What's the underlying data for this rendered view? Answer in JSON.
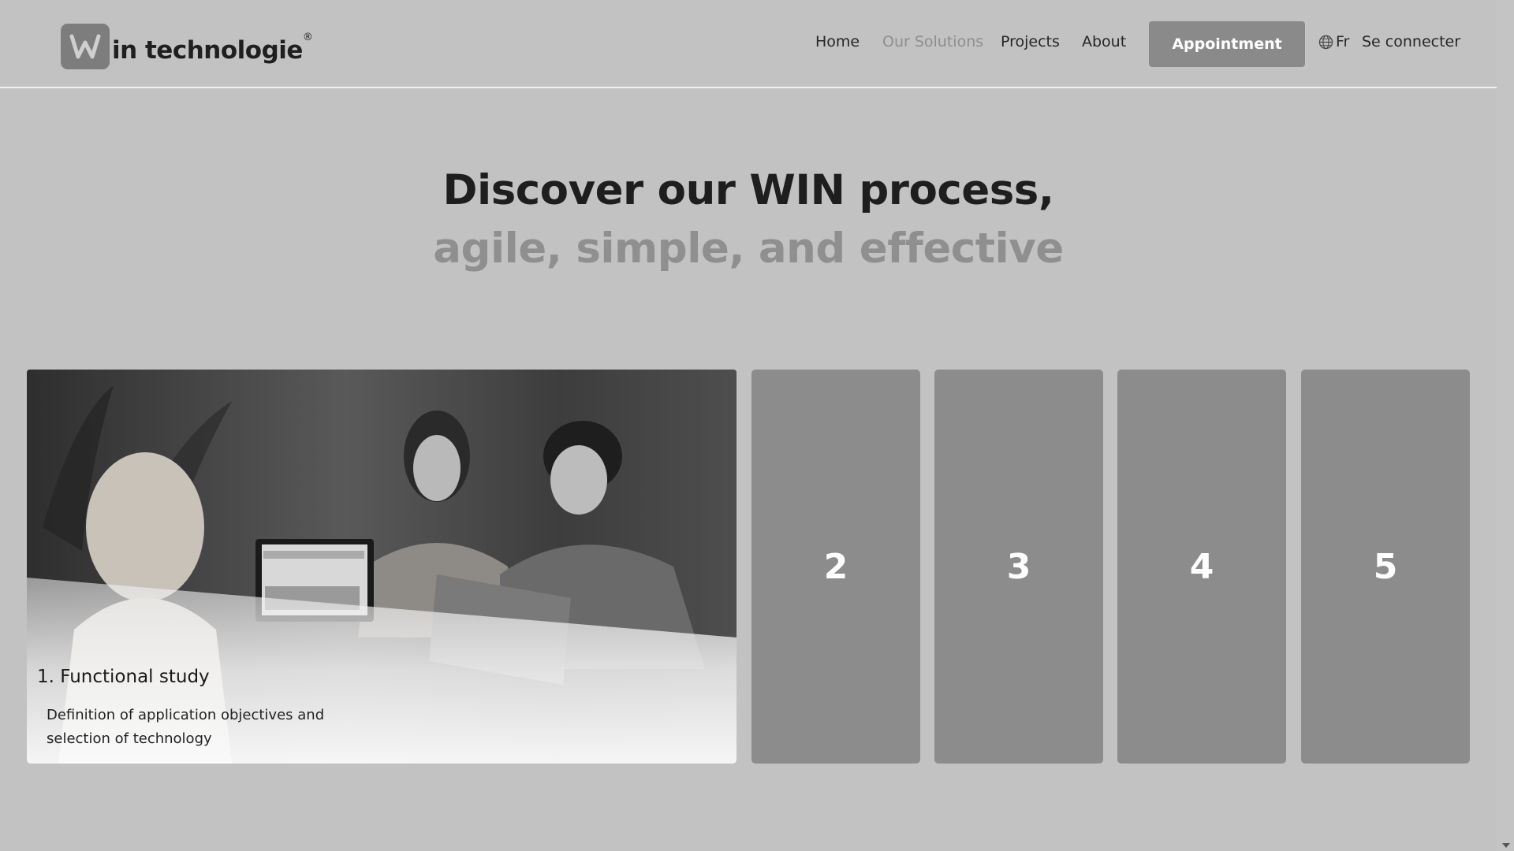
{
  "header": {
    "logo_text": "in technologie",
    "logo_mark": "W",
    "logo_registered": "®",
    "nav": [
      {
        "label": "Home",
        "active": false
      },
      {
        "label": "Our Solutions",
        "active": true
      },
      {
        "label": "Projects",
        "active": false
      },
      {
        "label": "About",
        "active": false
      }
    ],
    "appointment_label": "Appointment",
    "language_label": "Fr",
    "login_label": "Se connecter"
  },
  "hero": {
    "line1": "Discover our WIN process,",
    "line2": "agile, simple, and effective"
  },
  "process": {
    "active_step": {
      "title": "1. Functional study",
      "description": "Definition of application objectives and selection of technology",
      "image_icon": "team-meeting-photo"
    },
    "steps": [
      "2",
      "3",
      "4",
      "5"
    ]
  },
  "colors": {
    "background": "#c2c2c2",
    "button": "#8a8a8a",
    "step_card": "#8c8c8c",
    "heading_dark": "#1e1e1e",
    "heading_muted": "#8f8f8f"
  }
}
